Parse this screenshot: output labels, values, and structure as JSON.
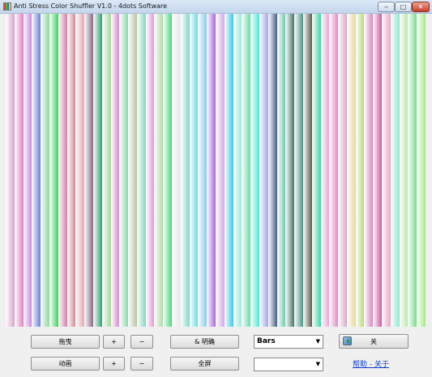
{
  "window": {
    "title": "Anti Stress Color Shuffler V1.0 - 4dots Software",
    "minimize_glyph": "‒",
    "maximize_glyph": "□",
    "close_glyph": "✕"
  },
  "canvas": {
    "bar_colors": [
      "#d6a3c8",
      "#e07fc0",
      "#c87ed6",
      "#5b76d6",
      "#7fd694",
      "#3ad35c",
      "#d47fa0",
      "#c87f86",
      "#e0a0a8",
      "#7a5b7e",
      "#2ea06c",
      "#a6d69c",
      "#d07fc8",
      "#7fd6a4",
      "#b8c2a0",
      "#7fd6c0",
      "#e08fd0",
      "#a8d6a0",
      "#3ad36e",
      "#e6e6e6",
      "#80d6c8",
      "#5bd6e6",
      "#7fc6e6",
      "#a05bd6",
      "#d0a8e6",
      "#3ac6e6",
      "#8fe6d8",
      "#5bd6a0",
      "#3ae6d0",
      "#a0a8e6",
      "#4a5a86",
      "#5bc6a6",
      "#2e6a5a",
      "#3a8a7a",
      "#5a5a4a",
      "#3ad6a0",
      "#e6a0d0",
      "#e07fc0",
      "#d6a8c8",
      "#e6d89a",
      "#b0d66a",
      "#d07fb8",
      "#c84a9c",
      "#e6a8c0",
      "#8fe6d0",
      "#b0e6a0",
      "#6ad67e",
      "#a0e67e"
    ]
  },
  "controls": {
    "drag_label": "拖曳",
    "speed_up_label": "+",
    "speed_down_label": "−",
    "brightness_label": "& 明确",
    "mode_value": "Bars",
    "mode_arrow": "▼",
    "close_label": "关",
    "close_icon": "exit-icon",
    "animation_label": "动画",
    "anim_up_label": "+",
    "anim_down_label": "−",
    "fullscreen_label": "全屏",
    "secondary_value": "",
    "secondary_arrow": "▼",
    "help_link": "帮助 - 关于"
  }
}
